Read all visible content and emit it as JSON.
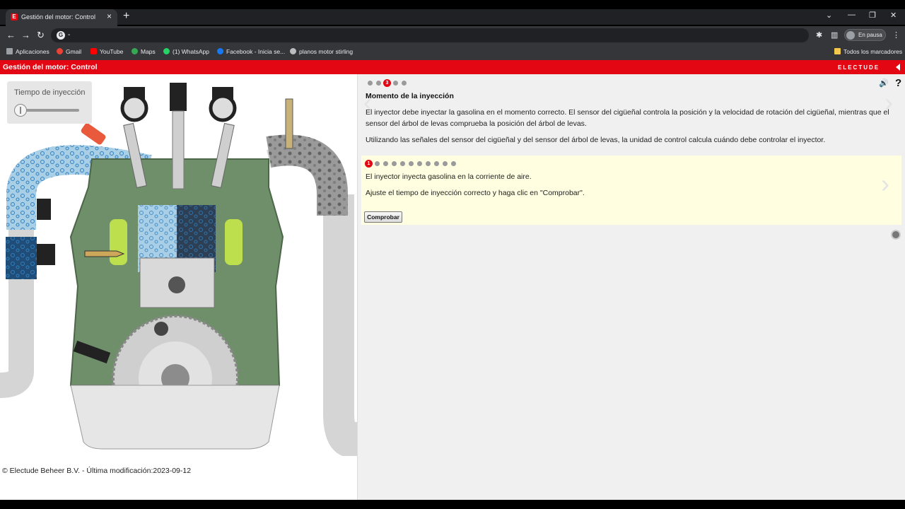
{
  "browser": {
    "tab_title": "Gestión del motor: Control",
    "tab_favicon": "E",
    "url": "-",
    "profile_label": "En pausa",
    "bookmarks": [
      "Aplicaciones",
      "Gmail",
      "YouTube",
      "Maps",
      "(1) WhatsApp",
      "Facebook - Inicia se...",
      "planos motor stirling"
    ],
    "all_bookmarks": "Todos los marcadores"
  },
  "app": {
    "title": "Gestión del motor: Control",
    "brand": "ELECTUDE"
  },
  "left": {
    "slider_label": "Tiempo de inyección",
    "slider_level": 0,
    "copyright": "© Electude Beheer B.V. - Última modificación:2023-09-12"
  },
  "right": {
    "page_indicator": "3",
    "section_title": "Momento de la inyección",
    "paragraph1": "El inyector debe inyectar la gasolina en el momento correcto. El sensor del cigüeñal controla la posición y la velocidad de rotación del cigüeñal, mientras que el sensor del árbol de levas comprueba la posición del árbol de levas.",
    "paragraph2": "Utilizando las señales del sensor del cigüeñal y del sensor del árbol de levas, la unidad de control calcula cuándo debe controlar el inyector.",
    "task": {
      "step_indicator": "1",
      "line1": "El inyector inyecta gasolina en la corriente de aire.",
      "line2": "Ajuste el tiempo de inyección correcto y haga clic en \"Comprobar\".",
      "button": "Comprobar"
    }
  },
  "colors": {
    "brand_red": "#e30613",
    "engine_green": "#6f8f6b",
    "task_bg": "#fffee0"
  }
}
